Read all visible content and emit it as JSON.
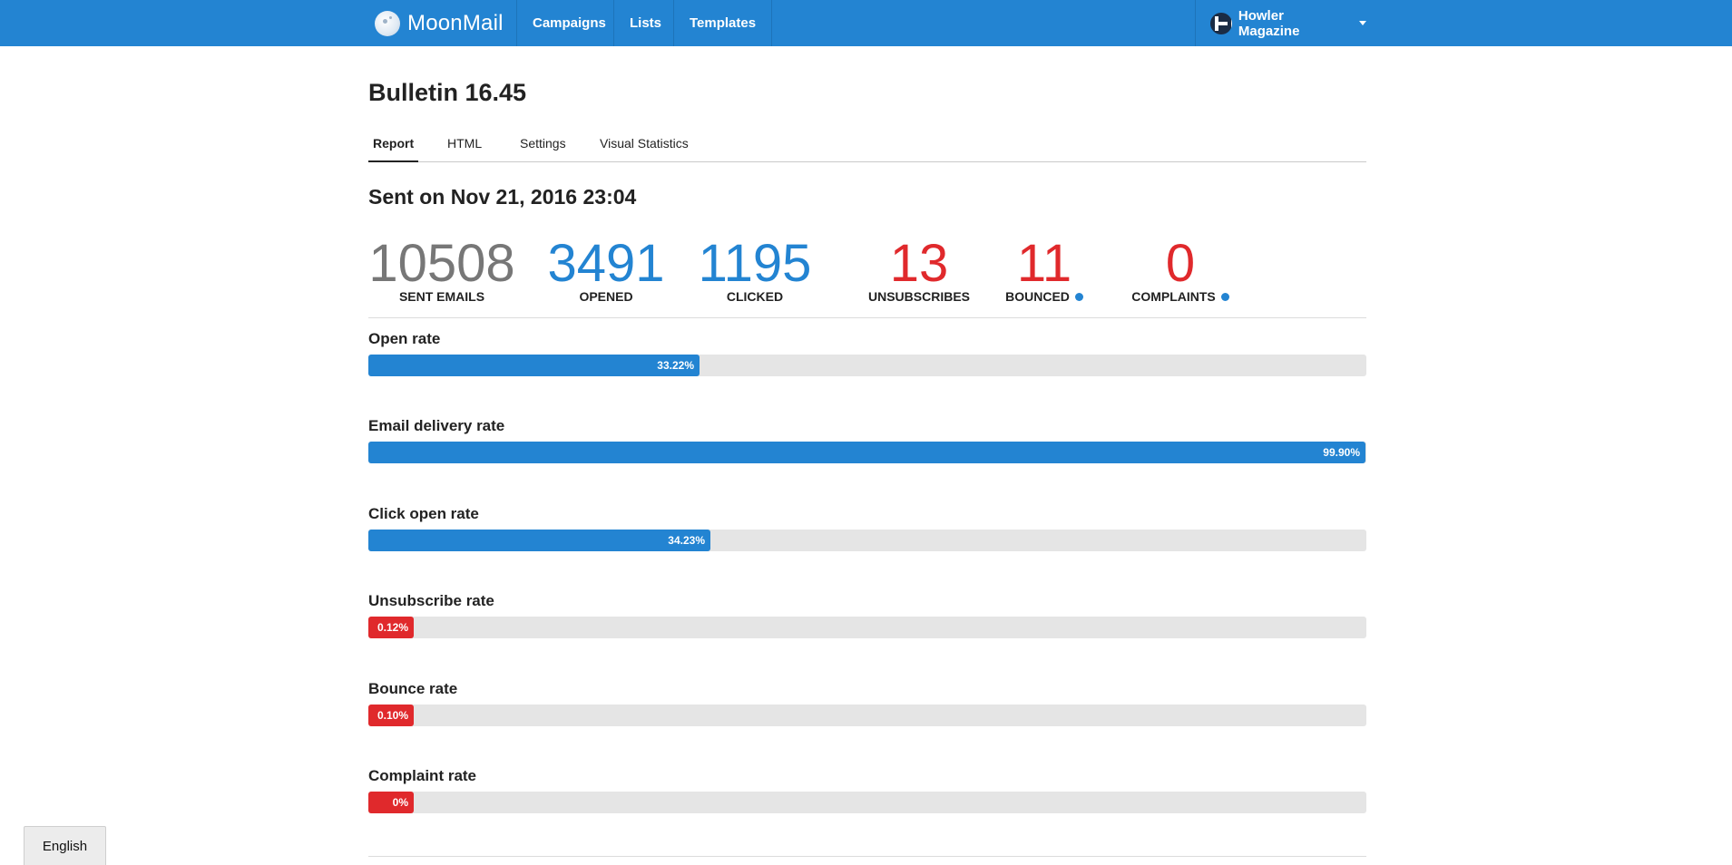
{
  "navbar": {
    "brand": "MoonMail",
    "links": [
      "Campaigns",
      "Lists",
      "Templates"
    ],
    "account": "Howler Magazine"
  },
  "page": {
    "title": "Bulletin 16.45",
    "tabs": [
      "Report",
      "HTML",
      "Settings",
      "Visual Statistics"
    ],
    "active_tab": "Report",
    "sent_on": "Sent on Nov 21, 2016 23:04"
  },
  "stats": [
    {
      "value": "10508",
      "label": "SENT EMAILS",
      "color": "#777777",
      "info": false
    },
    {
      "value": "3491",
      "label": "OPENED",
      "color": "#2384d2",
      "info": false
    },
    {
      "value": "1195",
      "label": "CLICKED",
      "color": "#2384d2",
      "info": false
    },
    {
      "value": "13",
      "label": "UNSUBSCRIBES",
      "color": "#e0292c",
      "info": false
    },
    {
      "value": "11",
      "label": "BOUNCED",
      "color": "#e0292c",
      "info": true
    },
    {
      "value": "0",
      "label": "COMPLAINTS",
      "color": "#e0292c",
      "info": true
    }
  ],
  "rates": [
    {
      "label": "Open rate",
      "value_text": "33.22%",
      "percent": 33.22,
      "color": "#2384d2"
    },
    {
      "label": "Email delivery rate",
      "value_text": "99.90%",
      "percent": 99.9,
      "color": "#2384d2"
    },
    {
      "label": "Click open rate",
      "value_text": "34.23%",
      "percent": 34.23,
      "color": "#2384d2"
    },
    {
      "label": "Unsubscribe rate",
      "value_text": "0.12%",
      "percent": 0.12,
      "color": "#e0292c"
    },
    {
      "label": "Bounce rate",
      "value_text": "0.10%",
      "percent": 0.1,
      "color": "#e0292c"
    },
    {
      "label": "Complaint rate",
      "value_text": "0%",
      "percent": 0,
      "color": "#e0292c"
    }
  ],
  "footer": {
    "language": "English"
  },
  "colors": {
    "primary": "#2384d2",
    "danger": "#e0292c",
    "muted": "#777777"
  }
}
